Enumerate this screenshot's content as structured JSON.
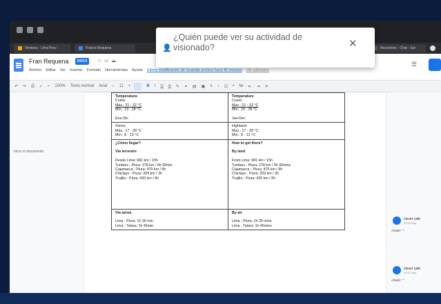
{
  "browser": {
    "tabs": [
      {
        "label": "Ventana - Lima Peru",
        "color": "#f9ab00"
      },
      {
        "label": "Franco Requena",
        "color": "#4285f4"
      },
      {
        "label": "Reuniones - Chat - Sur",
        "color": "#5f6368"
      }
    ]
  },
  "docs": {
    "title": "Fran Requena",
    "badge": "DOCX",
    "menu": [
      "Archivo",
      "Editar",
      "Ver",
      "Insertar",
      "Formato",
      "Herramientas",
      "Ayuda"
    ],
    "last_edit": "Última modificación de Guardar archivo hace 40 minutos",
    "edit_mode": "Ver ediciones",
    "toolbar": [
      "100%",
      "Texto normal",
      "Arial",
      "11",
      "B",
      "I",
      "U",
      "A"
    ],
    "outline_label": "Inicio el documento"
  },
  "dialog": {
    "text": "¿Quién puede ver su actividad de visionado?",
    "icon": "person-add-icon",
    "close_icon": "close-icon"
  },
  "table": {
    "rows": [
      {
        "left": [
          {
            "t": "Temperatura",
            "b": true
          },
          {
            "t": "Costa:"
          },
          {
            "t": "Máx.: 21 - 32 °C",
            "u": true
          },
          {
            "t": "Mín.: 19 - 28 °C"
          },
          {
            "t": ""
          },
          {
            "t": "Ene-Dic"
          }
        ],
        "right": [
          {
            "t": "Temperature",
            "b": true
          },
          {
            "t": "Coast:"
          },
          {
            "t": "Max.: 21 - 32 °C",
            "u": true
          },
          {
            "t": "Min.: 19 - 28 °C"
          },
          {
            "t": ""
          },
          {
            "t": "Jan-Dec"
          }
        ]
      },
      {
        "left": [
          {
            "t": "Sierra:"
          },
          {
            "t": "Máx.: 17 - 28 °C"
          },
          {
            "t": "Mín.: 8 - 13 °C"
          }
        ],
        "right": [
          {
            "t": "Highland:"
          },
          {
            "t": "Max.: 17 - 28 °C"
          },
          {
            "t": "Min.: 8 - 13 °C"
          }
        ]
      },
      {
        "left": [
          {
            "t": "¿Cómo llegar?",
            "b": true
          },
          {
            "t": ""
          },
          {
            "t": "Vía terrestre",
            "b": true
          },
          {
            "t": ""
          },
          {
            "t": "Desde Lima: 981 km / 15h"
          },
          {
            "t": "Tumbes - Piura: 278 km / 5h 30min"
          },
          {
            "t": "Cajamarca - Piura: 470 km / 9h"
          },
          {
            "t": "Chiclayo - Piura: 209 km / 3h"
          },
          {
            "t": "Trujillo - Piura: 420 km / 6h"
          },
          {
            "t": ""
          },
          {
            "t": ""
          },
          {
            "t": ""
          },
          {
            "t": ""
          },
          {
            "t": ""
          },
          {
            "t": ""
          }
        ],
        "right": [
          {
            "t": "How to get there?",
            "b": true
          },
          {
            "t": ""
          },
          {
            "t": "By land",
            "b": true
          },
          {
            "t": ""
          },
          {
            "t": "From Lima: 981 km / 15h"
          },
          {
            "t": "Tumbes - Piura: 278 km / 5h 30mins"
          },
          {
            "t": "Cajamarca - Piura: 470 km / 9h"
          },
          {
            "t": "Chiclayo - Piura: 209 km / 3h"
          },
          {
            "t": "Trujillo - Piura: 420 km / 6h"
          }
        ]
      },
      {
        "left": [
          {
            "t": "Vía aérea",
            "b": true
          },
          {
            "t": ""
          },
          {
            "t": "Lima - Piura: 1h 30 min"
          },
          {
            "t": "Lima - Talara: 1h 45min"
          }
        ],
        "right": [
          {
            "t": "By air",
            "b": true
          },
          {
            "t": ""
          },
          {
            "t": "Lima - Piura: 1h 30 mins"
          },
          {
            "t": "Lima - Talara: 1h 45mins"
          }
        ]
      }
    ]
  },
  "comments": [
    {
      "name": "clever cafe",
      "time": "20:18 Hoy",
      "assigned": "Añadir: \"\""
    },
    {
      "name": "clever cafe",
      "time": "20:17 Hoy",
      "assigned": "Añadir: \"\""
    }
  ]
}
